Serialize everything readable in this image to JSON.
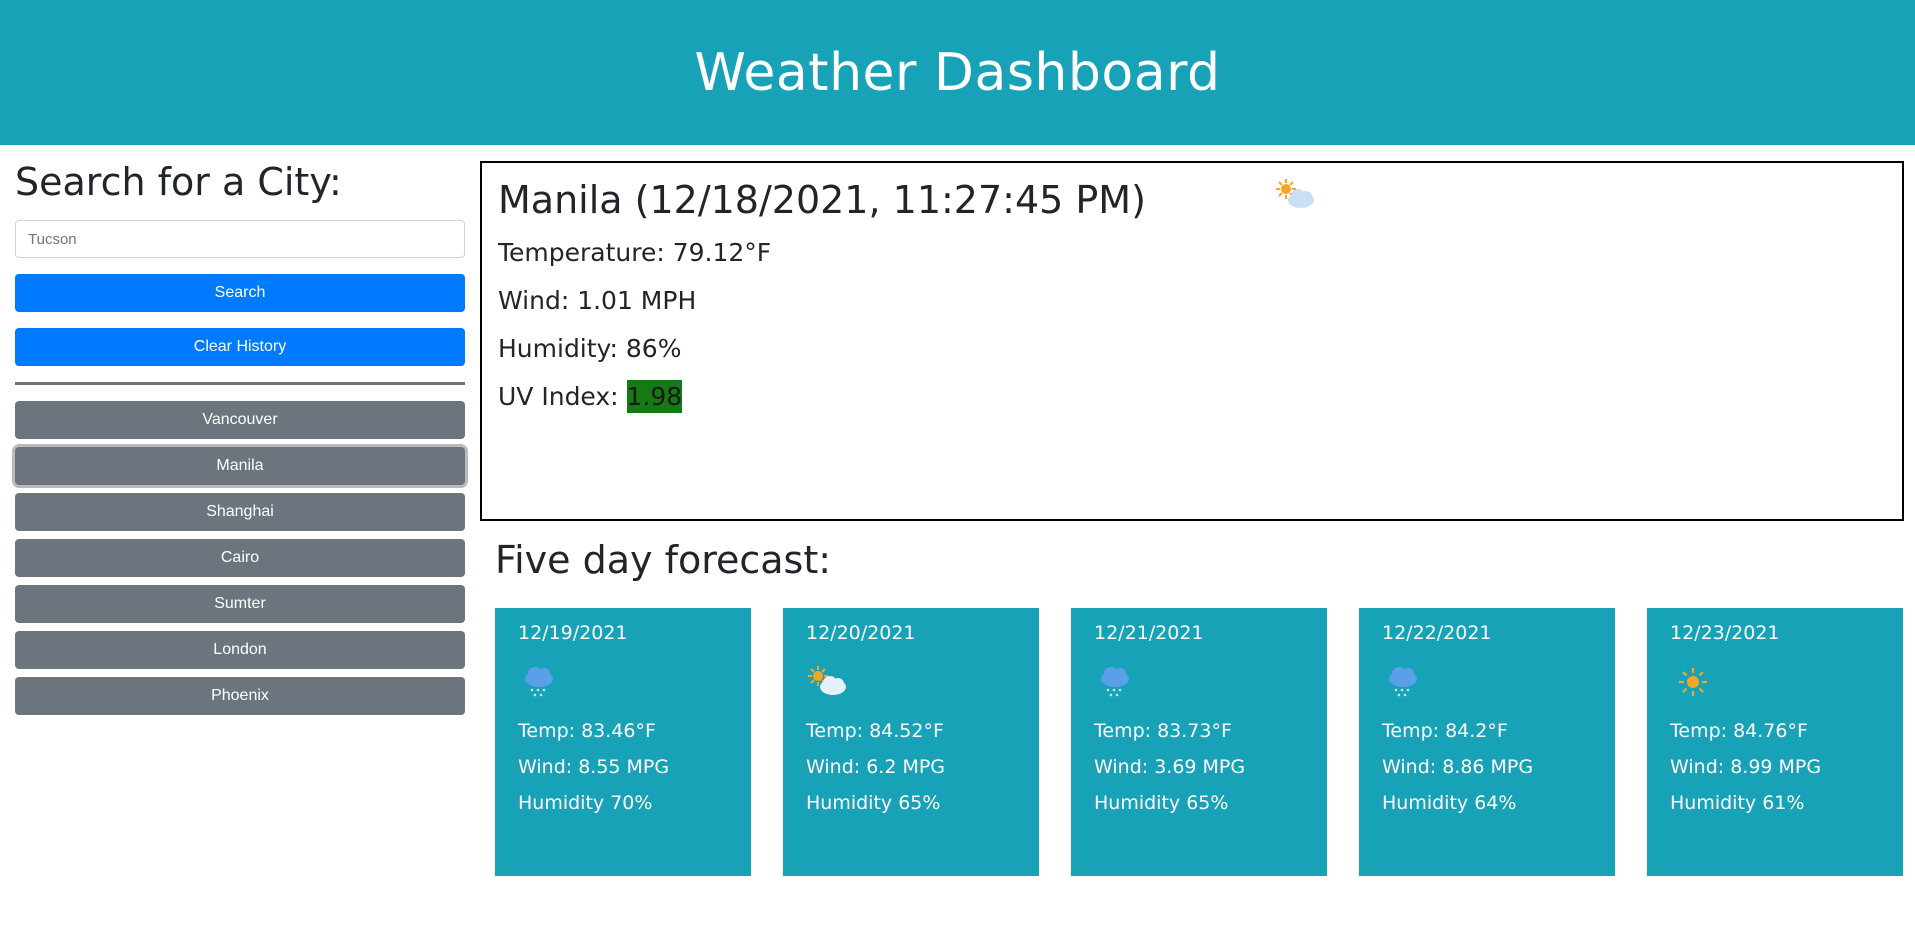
{
  "header": {
    "title": "Weather Dashboard"
  },
  "sidebar": {
    "heading": "Search for a City:",
    "search_value": "Tucson",
    "search_placeholder": "Tucson",
    "search_button": "Search",
    "clear_button": "Clear History",
    "history": [
      "Vancouver",
      "Manila",
      "Shanghai",
      "Cairo",
      "Sumter",
      "London",
      "Phoenix"
    ],
    "active_history": "Manila"
  },
  "current": {
    "title": "Manila (12/18/2021, 11:27:45 PM)",
    "icon": "partly-cloudy-icon",
    "temperature": "Temperature: 79.12°F",
    "wind": "Wind: 1.01 MPH",
    "humidity": "Humidity: 86%",
    "uv_label": "UV Index: ",
    "uv_value": "1.98",
    "uv_color": "#157a15"
  },
  "forecast": {
    "title": "Five day forecast:",
    "days": [
      {
        "date": "12/19/2021",
        "icon": "rain-cloud-icon",
        "temp": "Temp: 83.46°F",
        "wind": "Wind: 8.55 MPG",
        "humidity": "Humidity 70%"
      },
      {
        "date": "12/20/2021",
        "icon": "partly-cloudy-icon",
        "temp": "Temp: 84.52°F",
        "wind": "Wind: 6.2 MPG",
        "humidity": "Humidity 65%"
      },
      {
        "date": "12/21/2021",
        "icon": "rain-cloud-icon",
        "temp": "Temp: 83.73°F",
        "wind": "Wind: 3.69 MPG",
        "humidity": "Humidity 65%"
      },
      {
        "date": "12/22/2021",
        "icon": "rain-cloud-icon",
        "temp": "Temp: 84.2°F",
        "wind": "Wind: 8.86 MPG",
        "humidity": "Humidity 64%"
      },
      {
        "date": "12/23/2021",
        "icon": "sun-icon",
        "temp": "Temp: 84.76°F",
        "wind": "Wind: 8.99 MPG",
        "humidity": "Humidity 61%"
      }
    ]
  },
  "colors": {
    "header_bg": "#17a2b8",
    "primary": "#007bff",
    "secondary": "#6c757d",
    "forecast_card": "#17a2b8"
  }
}
